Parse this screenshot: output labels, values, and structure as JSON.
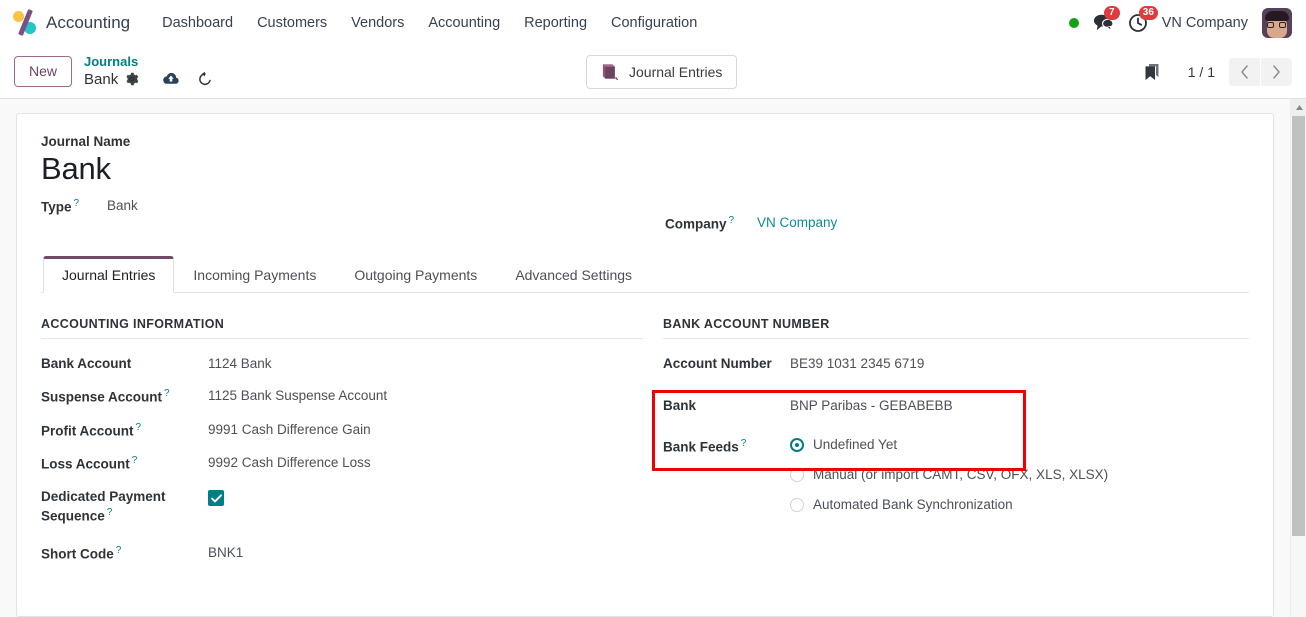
{
  "navbar": {
    "brand": "Accounting",
    "logo_icon": "odoo-logo-icon",
    "menu": [
      {
        "label": "Dashboard"
      },
      {
        "label": "Customers"
      },
      {
        "label": "Vendors"
      },
      {
        "label": "Accounting"
      },
      {
        "label": "Reporting"
      },
      {
        "label": "Configuration"
      }
    ],
    "status_dot_color": "#15a015",
    "messages_badge": "7",
    "activities_badge": "36",
    "company": "VN Company",
    "avatar_alt": "user-avatar"
  },
  "control_panel": {
    "new_label": "New",
    "breadcrumb_parent": "Journals",
    "breadcrumb_current": "Bank",
    "gear_icon": "gear-icon",
    "save_icon": "cloud-upload-icon",
    "discard_icon": "undo-icon",
    "smart_button_label": "Journal Entries",
    "smart_button_icon": "book-icon",
    "bookmark_icon": "bookmark-icon",
    "pager": "1 / 1",
    "pager_prev_icon": "chevron-left-icon",
    "pager_next_icon": "chevron-right-icon"
  },
  "form": {
    "journal_name_label": "Journal Name",
    "journal_name": "Bank",
    "type_label": "Type",
    "type_value": "Bank",
    "company_label": "Company",
    "company_value": "VN Company",
    "help_marker": "?"
  },
  "tabs": [
    {
      "label": "Journal Entries",
      "active": true
    },
    {
      "label": "Incoming Payments",
      "active": false
    },
    {
      "label": "Outgoing Payments",
      "active": false
    },
    {
      "label": "Advanced Settings",
      "active": false
    }
  ],
  "accounting_information": {
    "group_title": "ACCOUNTING INFORMATION",
    "fields": [
      {
        "label": "Bank Account",
        "help": false,
        "value": "1124 Bank"
      },
      {
        "label": "Suspense Account",
        "help": true,
        "value": "1125 Bank Suspense Account"
      },
      {
        "label": "Profit Account",
        "help": true,
        "value": "9991 Cash Difference Gain"
      },
      {
        "label": "Loss Account",
        "help": true,
        "value": "9992 Cash Difference Loss"
      }
    ],
    "dedicated_payment_sequence_label_line1": "Dedicated Payment",
    "dedicated_payment_sequence_label_line2": "Sequence",
    "dedicated_payment_sequence_checked": true,
    "short_code_label": "Short Code",
    "short_code_value": "BNK1"
  },
  "bank_account_number": {
    "group_title": "BANK ACCOUNT NUMBER",
    "account_number_label": "Account Number",
    "account_number_value": "BE39 1031 2345 6719",
    "bank_label": "Bank",
    "bank_value": "BNP Paribas - GEBABEBB",
    "bank_feeds_label": "Bank Feeds",
    "bank_feeds_options": [
      {
        "label": "Undefined Yet",
        "selected": true
      },
      {
        "label": "Manual (or import CAMT, CSV, OFX, XLS, XLSX)",
        "selected": false
      },
      {
        "label": "Automated Bank Synchronization",
        "selected": false
      }
    ]
  },
  "annotation": {
    "highlight_color": "#f10000",
    "target": "account-number-and-bank-fields"
  },
  "theme": {
    "accent_teal": "#017e84",
    "accent_purple": "#714b67",
    "badge_red": "#e03a3e",
    "link_teal": "#0d8b95"
  }
}
